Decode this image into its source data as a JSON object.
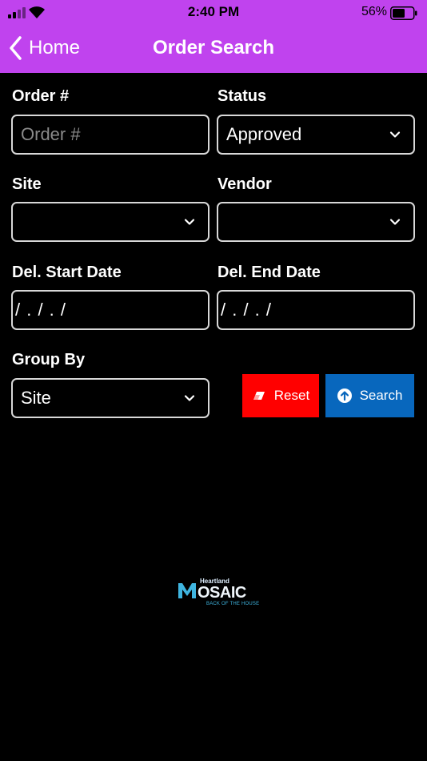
{
  "status_bar": {
    "time": "2:40 PM",
    "battery": "56%",
    "icons": [
      "signal-icon",
      "wifi-icon",
      "battery-icon"
    ]
  },
  "nav": {
    "back_label": "Home",
    "title": "Order Search",
    "background_color": "#c043ee"
  },
  "form": {
    "order": {
      "label": "Order #",
      "placeholder": "Order #",
      "value": ""
    },
    "status": {
      "label": "Status",
      "value": "Approved"
    },
    "site": {
      "label": "Site",
      "value": ""
    },
    "vendor": {
      "label": "Vendor",
      "value": ""
    },
    "start_date": {
      "label": "Del. Start Date",
      "value": "/ . / . /"
    },
    "end_date": {
      "label": "Del. End Date",
      "value": "/ . / . /"
    },
    "group_by": {
      "label": "Group By",
      "value": "Site"
    }
  },
  "buttons": {
    "reset": {
      "label": "Reset",
      "color": "#ff0000",
      "icon": "eraser-icon"
    },
    "search": {
      "label": "Search",
      "color": "#0867bd",
      "icon": "arrow-up-circle-icon"
    }
  },
  "logo": {
    "brand_small": "Heartland",
    "word": "OSAIC",
    "tagline": "BACK OF THE HOUSE"
  }
}
